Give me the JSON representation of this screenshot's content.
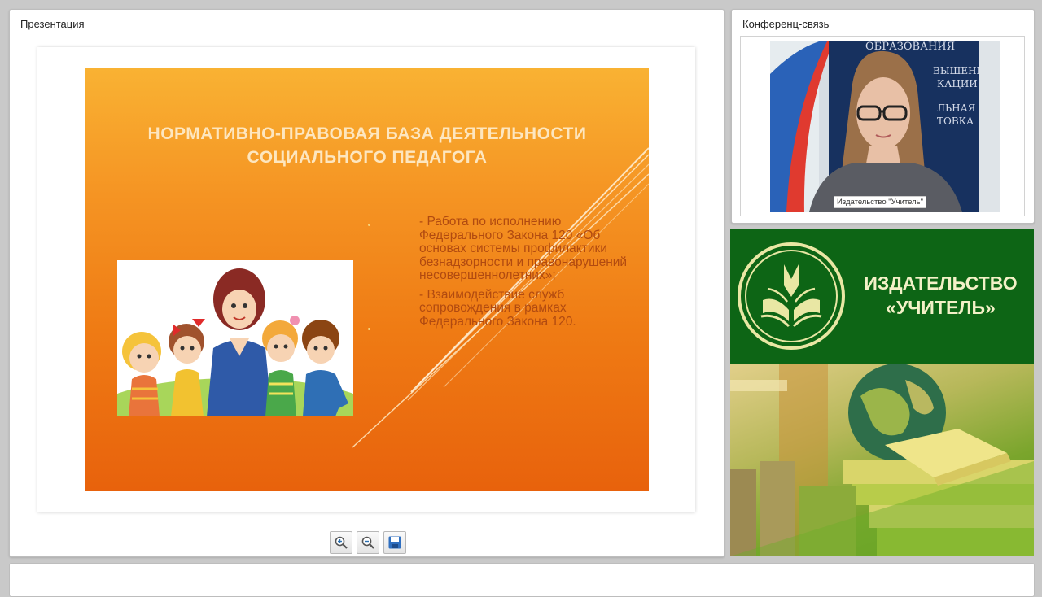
{
  "presentation": {
    "title": "Презентация",
    "slide": {
      "title_line1": "Нормативно-правовая база деятельности",
      "title_line2": "социального педагога",
      "bullets": [
        "- Работа по исполнению Федерального Закона 120 «Об основах системы профилактики безнадзорности и правонарушений несовершеннолетних»;",
        "- Взаимодействие служб сопровождения в рамках Федерального Закона 120."
      ],
      "illustration_icon": "teacher-with-children-picture"
    },
    "toolbar": {
      "zoom_in_icon": "zoom-in-icon",
      "zoom_out_icon": "zoom-out-icon",
      "save_icon": "save-icon"
    }
  },
  "conference": {
    "title": "Конференц-связь",
    "video_caption": "Издательство \"Учитель\"",
    "backdrop_lines": [
      "ОБРАЗОВАНИЯ",
      "ВЫШЕНИЕ",
      "КАЦИИ",
      "ЛЬНАЯ",
      "ТОВКА"
    ]
  },
  "publisher": {
    "name_line1": "ИЗДАТЕЛЬСТВО",
    "name_line2": "«УЧИТЕЛЬ»",
    "logo_icon": "open-book-logo-icon"
  },
  "colors": {
    "slide_orange": "#f08019",
    "publisher_green": "#0d6515",
    "title_cream": "#fde6bf"
  }
}
